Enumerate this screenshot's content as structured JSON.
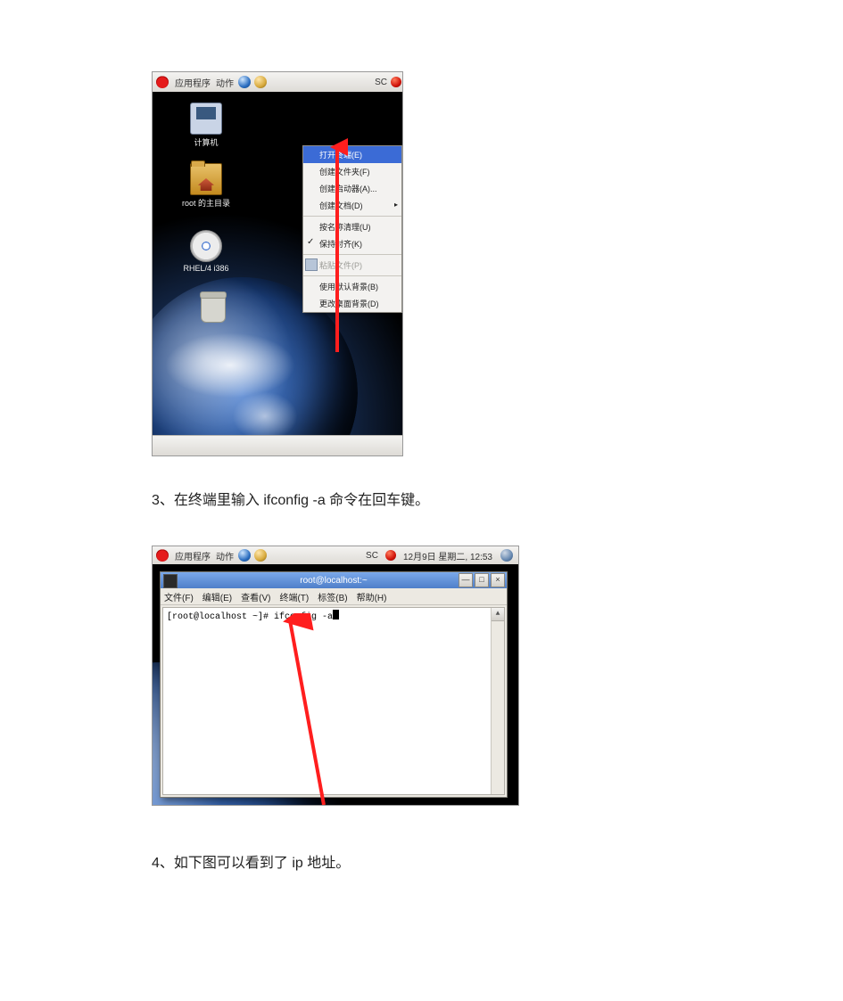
{
  "panel": {
    "apps": "应用程序",
    "actions": "动作",
    "input_label": "SC",
    "clock": "12月9日 星期二, 12:53"
  },
  "desktop_icons": {
    "computer": "计算机",
    "home": "root 的主目录",
    "cd": "RHEL/4 i386",
    "trash": ""
  },
  "context_menu": {
    "open_terminal": "打开终端(E)",
    "new_folder": "创建文件夹(F)",
    "new_launcher": "创建启动器(A)...",
    "new_document": "创建文档(D)",
    "clean_by_name": "按名称清理(U)",
    "keep_aligned": "保持对齐(K)",
    "paste": "粘贴文件(P)",
    "use_default_bg": "使用默认背景(B)",
    "change_bg": "更改桌面背景(D)"
  },
  "steps": {
    "s3": "3、在终端里输入 ifconfig  -a 命令在回车键。",
    "s4": "4、如下图可以看到了 ip 地址。"
  },
  "terminal": {
    "title": "root@localhost:~",
    "menu_file": "文件(F)",
    "menu_edit": "编辑(E)",
    "menu_view": "查看(V)",
    "menu_term": "终端(T)",
    "menu_tabs": "标签(B)",
    "menu_help": "帮助(H)",
    "line": "[root@localhost ~]# ifconfig -a"
  }
}
